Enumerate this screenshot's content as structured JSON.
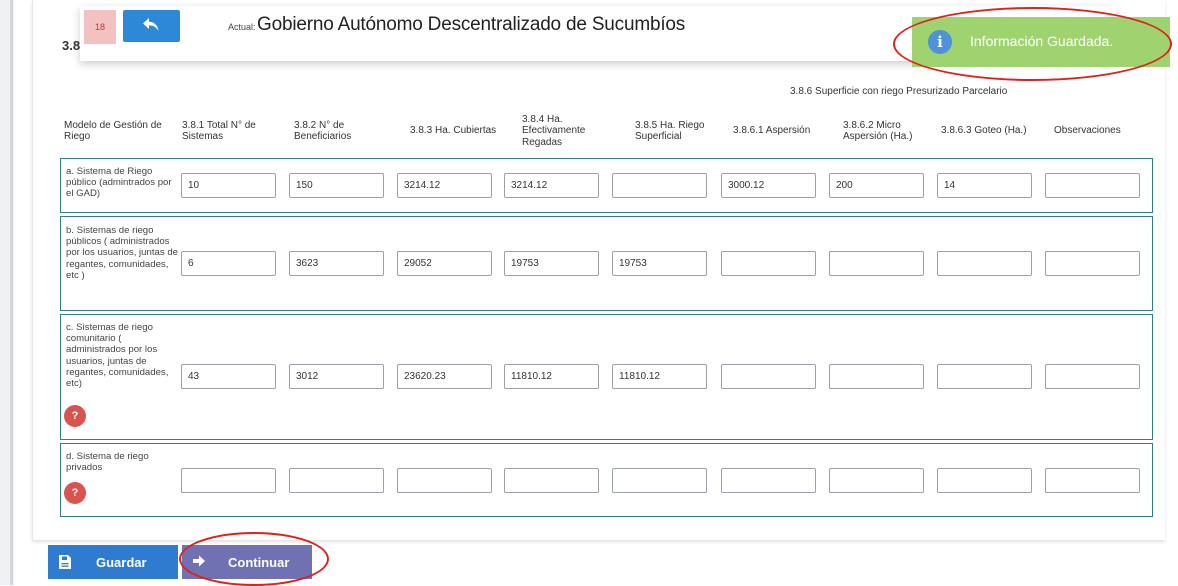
{
  "header": {
    "section_number": "3.8",
    "record_count": "18",
    "actual_label": "Actual:",
    "actual_name": "Gobierno Autónomo Descentralizado de Sucumbíos"
  },
  "toast": {
    "message": "Información Guardada.",
    "icon": "info-icon",
    "color": "#9fd36f"
  },
  "table": {
    "group_header": "3.8.6 Superficie con riego Presurizado Parcelario",
    "columns": [
      "Modelo de Gestión de Riego",
      "3.8.1 Total N° de Sistemas",
      "3.8.2 N° de Beneficiarios",
      "3.8.3 Ha. Cubiertas",
      "3.8.4 Ha. Efectivamente Regadas",
      "3.8.5 Ha. Riego Superficial",
      "3.8.6.1 Aspersión",
      "3.8.6.2 Micro Aspersión (Ha.)",
      "3.8.6.3 Goteo (Ha.)",
      "Observaciones"
    ],
    "rows": [
      {
        "label": "a. Sistema de Riego público (admintrados por el GAD)",
        "values": [
          "10",
          "150",
          "3214.12",
          "3214.12",
          "",
          "3000.12",
          "200",
          "14",
          ""
        ]
      },
      {
        "label": "b. Sistemas de riego públicos ( administrados por los usuarios, juntas de regantes, comunidades, etc )",
        "values": [
          "6",
          "3623",
          "29052",
          "19753",
          "19753",
          "",
          "",
          "",
          ""
        ]
      },
      {
        "label": "c. Sistemas de riego comunitario ( administrados por los usuarios, juntas de regantes, comunidades, etc)",
        "values": [
          "43",
          "3012",
          "23620.23",
          "11810.12",
          "11810.12",
          "",
          "",
          "",
          ""
        ],
        "help": "?"
      },
      {
        "label": "d. Sistema de riego privados",
        "values": [
          "",
          "",
          "",
          "",
          "",
          "",
          "",
          "",
          ""
        ],
        "help": "?"
      }
    ]
  },
  "buttons": {
    "save": "Guardar",
    "continue": "Continuar"
  },
  "colors": {
    "primary": "#2e7bcf",
    "continue": "#6f71b3",
    "row_border": "#2f7f85",
    "annotation": "#e0201b"
  }
}
